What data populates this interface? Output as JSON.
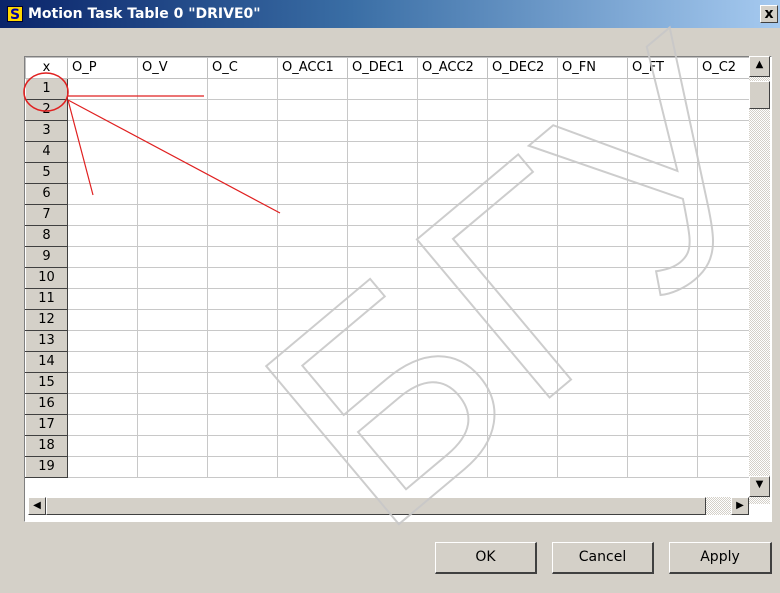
{
  "window": {
    "title": "Motion Task Table 0 \"DRIVE0\"",
    "app_icon_glyph": "S",
    "close_glyph": "x"
  },
  "table": {
    "corner_label": "x",
    "columns": [
      "O_P",
      "O_V",
      "O_C",
      "O_ACC1",
      "O_DEC1",
      "O_ACC2",
      "O_DEC2",
      "O_FN",
      "O_FT",
      "O_C2"
    ],
    "rows": [
      "1",
      "2",
      "3",
      "4",
      "5",
      "6",
      "7",
      "8",
      "9",
      "10",
      "11",
      "12",
      "13",
      "14",
      "15",
      "16",
      "17",
      "18",
      "19"
    ]
  },
  "scrollbars": {
    "up_glyph": "▲",
    "down_glyph": "▼",
    "left_glyph": "◀",
    "right_glyph": "▶"
  },
  "buttons": {
    "ok": "OK",
    "cancel": "Cancel",
    "apply": "Apply"
  },
  "annotations": {
    "color": "#e02020"
  },
  "watermark": {
    "text": "БГУ",
    "color": "#c8c8c8"
  }
}
